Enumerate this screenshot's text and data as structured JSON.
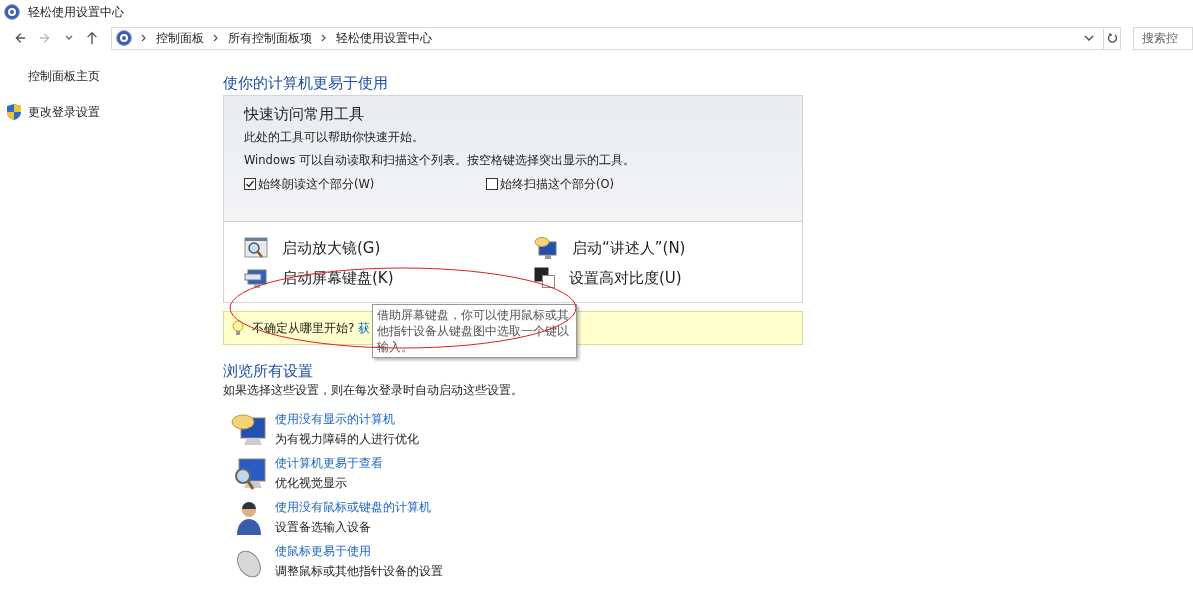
{
  "window": {
    "title": "轻松使用设置中心"
  },
  "address_bar": {
    "crumbs": [
      "控制面板",
      "所有控制面板项",
      "轻松使用设置中心"
    ]
  },
  "search": {
    "placeholder": "搜索控"
  },
  "sidebar": {
    "items": [
      {
        "label": "控制面板主页",
        "kind": "plain"
      },
      {
        "label": "更改登录设置",
        "kind": "shield"
      }
    ]
  },
  "quick_access": {
    "heading": "使你的计算机更易于使用",
    "title": "快速访问常用工具",
    "lines": [
      "此处的工具可以帮助你快速开始。",
      "Windows 可以自动读取和扫描这个列表。按空格键选择突出显示的工具。"
    ],
    "options": [
      {
        "label": "始终朗读这个部分(W)",
        "checked": true
      },
      {
        "label": "始终扫描这个部分(O)",
        "checked": false
      }
    ],
    "tools": [
      {
        "label": "启动放大镜(G)",
        "kind": "magnifier"
      },
      {
        "label": "启动“讲述人”(N)",
        "kind": "narrator"
      },
      {
        "label": "启动屏幕键盘(K)",
        "kind": "keyboard"
      },
      {
        "label": "设置高对比度(U)",
        "kind": "contrast"
      }
    ]
  },
  "tip": {
    "text": "不确定从哪里开始?",
    "link": "获"
  },
  "tooltip": {
    "text": "借助屏幕键盘，你可以使用鼠标或其他指针设备从键盘图中选取一个键以输入。"
  },
  "browse": {
    "heading": "浏览所有设置",
    "description": "如果选择这些设置，则在每次登录时自动启动这些设置。",
    "items": [
      {
        "link": "使用没有显示的计算机",
        "description": "为有视力障碍的人进行优化",
        "kind": "monitor-bubble"
      },
      {
        "link": "使计算机更易于查看",
        "description": "优化视觉显示",
        "kind": "monitor-magnifier"
      },
      {
        "link": "使用没有鼠标或键盘的计算机",
        "description": "设置备选输入设备",
        "kind": "person"
      },
      {
        "link": "使鼠标更易于使用",
        "description": "调整鼠标或其他指针设备的设置",
        "kind": "mouse"
      }
    ]
  }
}
